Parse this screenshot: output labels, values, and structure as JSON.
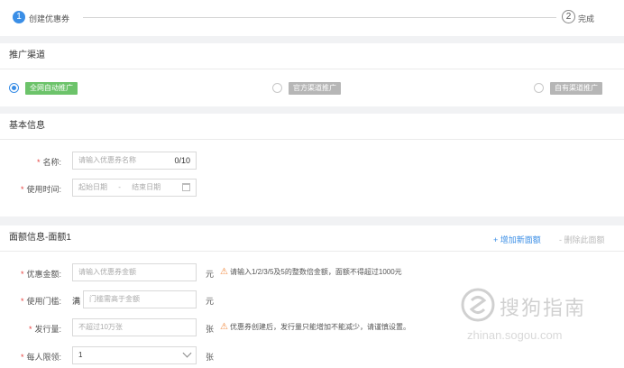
{
  "steps": [
    {
      "number": "1",
      "label": "创建优惠券"
    },
    {
      "number": "2",
      "label": "完成"
    }
  ],
  "channel": {
    "title": "推广渠道",
    "options": [
      {
        "label": "全网自动推广",
        "selected": true
      },
      {
        "label": "官方渠道推广",
        "selected": false
      },
      {
        "label": "自有渠道推广",
        "selected": false
      }
    ]
  },
  "basic": {
    "title": "基本信息",
    "name_label": "名称:",
    "name_placeholder": "请输入优惠券名称",
    "name_counter": "0/10",
    "time_label": "使用时间:",
    "start_placeholder": "起始日期",
    "range_sep": "-",
    "end_placeholder": "结束日期"
  },
  "denomination": {
    "title": "面额信息-面额1",
    "add_label": "+ 增加新面额",
    "delete_label": "- 删除此面额",
    "amount_label": "优惠金额:",
    "amount_placeholder": "请输入优惠券金额",
    "amount_unit": "元",
    "amount_hint": "请输入1/2/3/5及5的整数倍金额，面额不得超过1000元",
    "threshold_label": "使用门槛:",
    "threshold_prefix": "满",
    "threshold_placeholder": "门槛需高于金额",
    "threshold_unit": "元",
    "issue_label": "发行量:",
    "issue_placeholder": "不超过10万张",
    "issue_unit": "张",
    "issue_hint": "优惠券创建后，发行量只能增加不能减少，请谨慎设置。",
    "limit_label": "每人限领:",
    "limit_value": "1",
    "limit_unit": "张"
  },
  "watermark": {
    "text": "搜狗指南",
    "url": "zhinan.sogou.com"
  },
  "colors": {
    "accent": "#3a8ee6",
    "green_tag": "#6cc36a",
    "grey_tag": "#b6b6b6",
    "required": "#e64340",
    "warning": "#f0883e"
  }
}
